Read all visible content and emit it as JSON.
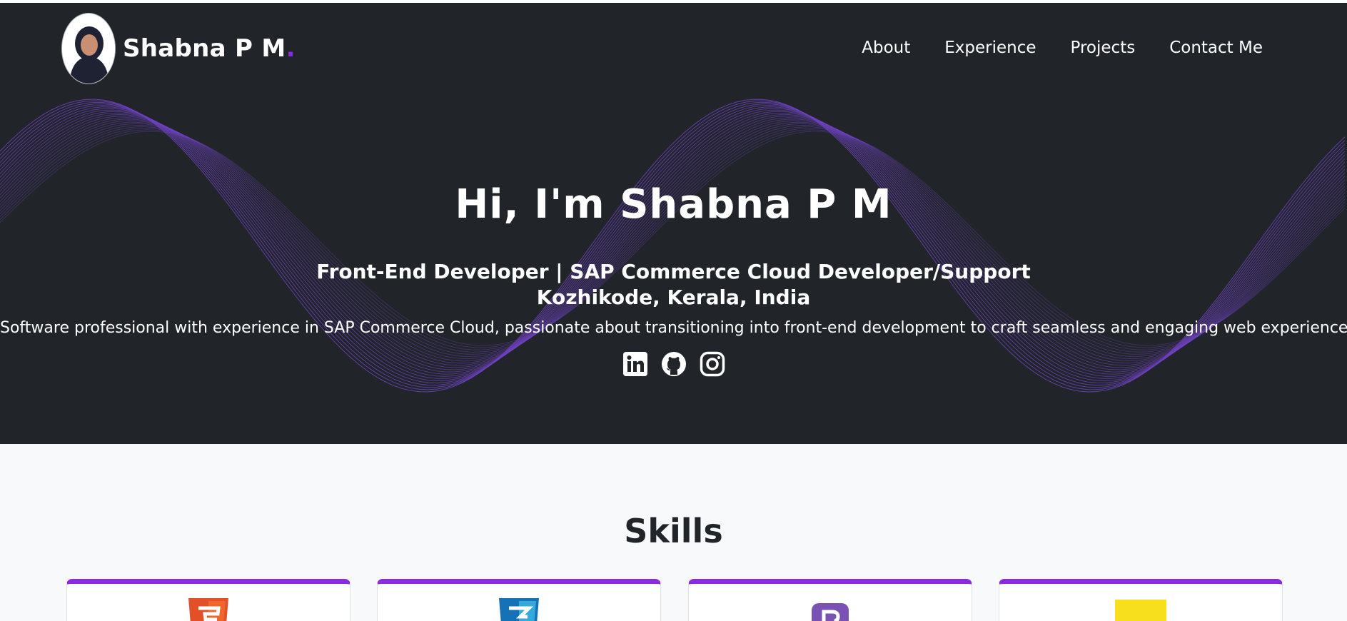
{
  "brand": {
    "name": "Shabna P M",
    "dot": ".",
    "accent_color": "#8a2be2"
  },
  "nav": {
    "items": [
      {
        "label": "About"
      },
      {
        "label": "Experience"
      },
      {
        "label": "Projects"
      },
      {
        "label": "Contact Me"
      }
    ]
  },
  "hero": {
    "title": "Hi, I'm Shabna P M",
    "subtitle": "Front-End Developer | SAP Commerce Cloud Developer/Support",
    "location": "Kozhikode, Kerala, India",
    "description": "Software professional with experience in SAP Commerce Cloud, passionate about transitioning into front-end development to craft seamless and engaging web experiences.",
    "background_color": "#212529",
    "wave_color": "#6f42c1"
  },
  "socials": [
    {
      "icon": "linkedin-icon"
    },
    {
      "icon": "github-icon"
    },
    {
      "icon": "instagram-icon"
    }
  ],
  "skills": {
    "title": "Skills",
    "cards": [
      {
        "icon": "html5-icon",
        "color": "#e34f26"
      },
      {
        "icon": "css3-icon",
        "color": "#1572b6"
      },
      {
        "icon": "bootstrap-icon",
        "color": "#7952b3"
      },
      {
        "icon": "javascript-icon",
        "color": "#f7df1e"
      }
    ]
  }
}
